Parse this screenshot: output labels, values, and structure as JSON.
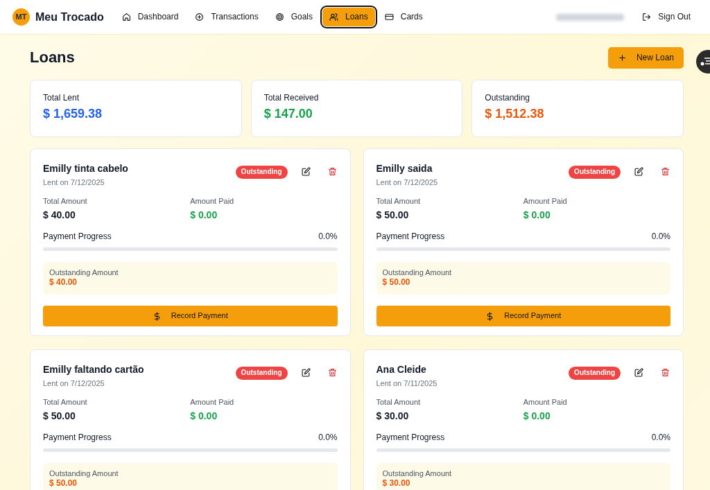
{
  "brand": {
    "initials": "MT",
    "name": "Meu Trocado"
  },
  "nav": [
    {
      "label": "Dashboard",
      "selected": false
    },
    {
      "label": "Transactions",
      "selected": false
    },
    {
      "label": "Goals",
      "selected": false
    },
    {
      "label": "Loans",
      "selected": true
    },
    {
      "label": "Cards",
      "selected": false
    }
  ],
  "sign_out": "Sign Out",
  "page_title": "Loans",
  "new_button": "New Loan",
  "stats": [
    {
      "label": "Total Lent",
      "value": "$ 1,659.38",
      "color": "#2563eb"
    },
    {
      "label": "Total Received",
      "value": "$ 147.00",
      "color": "#16a34a"
    },
    {
      "label": "Outstanding",
      "value": "$ 1,512.38",
      "color": "#ea580c"
    }
  ],
  "loans": [
    {
      "name": "Emilly tinta cabelo",
      "date": "Lent on 7/12/2025",
      "status": "Outstanding",
      "total_label": "Total Amount",
      "total": "$ 40.00",
      "paid_label": "Amount Paid",
      "paid": "$ 0.00",
      "progress_label": "Payment Progress",
      "progress_text": "0.0%",
      "level": 0,
      "outstanding_label": "Outstanding Amount",
      "outstanding": "$ 40.00",
      "action": "Record Payment"
    },
    {
      "name": "Emilly saida",
      "date": "Lent on 7/12/2025",
      "status": "Outstanding",
      "total_label": "Total Amount",
      "total": "$ 50.00",
      "paid_label": "Amount Paid",
      "paid": "$ 0.00",
      "progress_label": "Payment Progress",
      "progress_text": "0.0%",
      "level": 0,
      "outstanding_label": "Outstanding Amount",
      "outstanding": "$ 50.00",
      "action": "Record Payment"
    },
    {
      "name": "Emilly faltando cartão",
      "date": "Lent on 7/12/2025",
      "status": "Outstanding",
      "total_label": "Total Amount",
      "total": "$ 50.00",
      "paid_label": "Amount Paid",
      "paid": "$ 0.00",
      "progress_label": "Payment Progress",
      "progress_text": "0.0%",
      "level": 0,
      "outstanding_label": "Outstanding Amount",
      "outstanding": "$ 50.00"
    },
    {
      "name": "Ana Cleide",
      "date": "Lent on 7/11/2025",
      "status": "Outstanding",
      "total_label": "Total Amount",
      "total": "$ 30.00",
      "paid_label": "Amount Paid",
      "paid": "$ 0.00",
      "progress_label": "Payment Progress",
      "progress_text": "0.0%",
      "level": 0,
      "outstanding_label": "Outstanding Amount",
      "outstanding": "$ 30.00"
    }
  ]
}
